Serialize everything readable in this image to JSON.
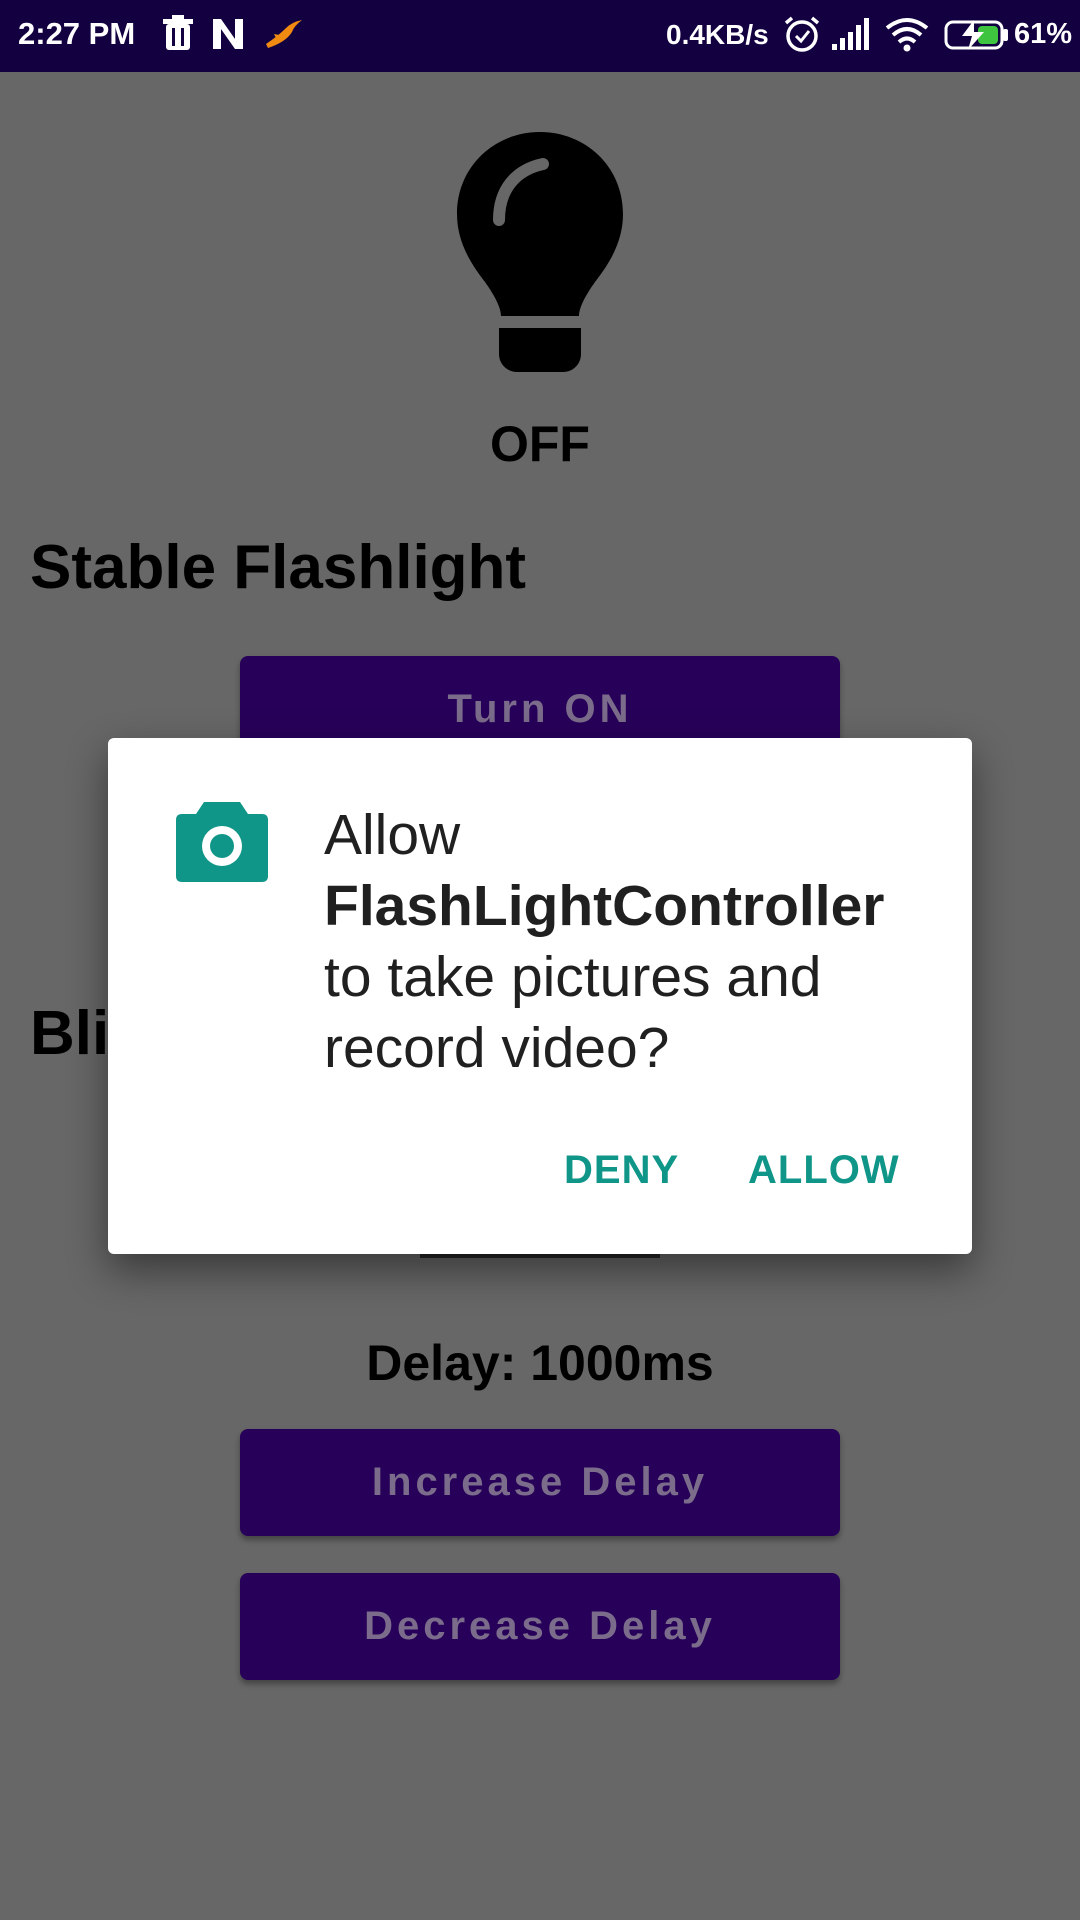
{
  "status_bar": {
    "time": "2:27 PM",
    "net_speed": "0.4KB/s",
    "battery": "61%",
    "icons": [
      "trash-icon",
      "n-icon",
      "bird-icon",
      "alarm-icon",
      "signal-icon",
      "wifi-icon",
      "battery-charging-icon"
    ]
  },
  "app": {
    "flash_state": "OFF",
    "stable_title": "Stable Flashlight",
    "turn_on_label": "Turn ON",
    "blink_title_partial": "Bli",
    "delay_label": "Delay: 1000ms",
    "increase_label": "Increase Delay",
    "decrease_label": "Decrease Delay"
  },
  "dialog": {
    "line1": "Allow",
    "app_name": "FlashLightController",
    "line3": "to take pictures and record video?",
    "deny_label": "DENY",
    "allow_label": "ALLOW",
    "accent_color": "#0f9688"
  },
  "colors": {
    "status_bar": "#130040",
    "button": "#270059",
    "scrim_bg": "#676767"
  }
}
